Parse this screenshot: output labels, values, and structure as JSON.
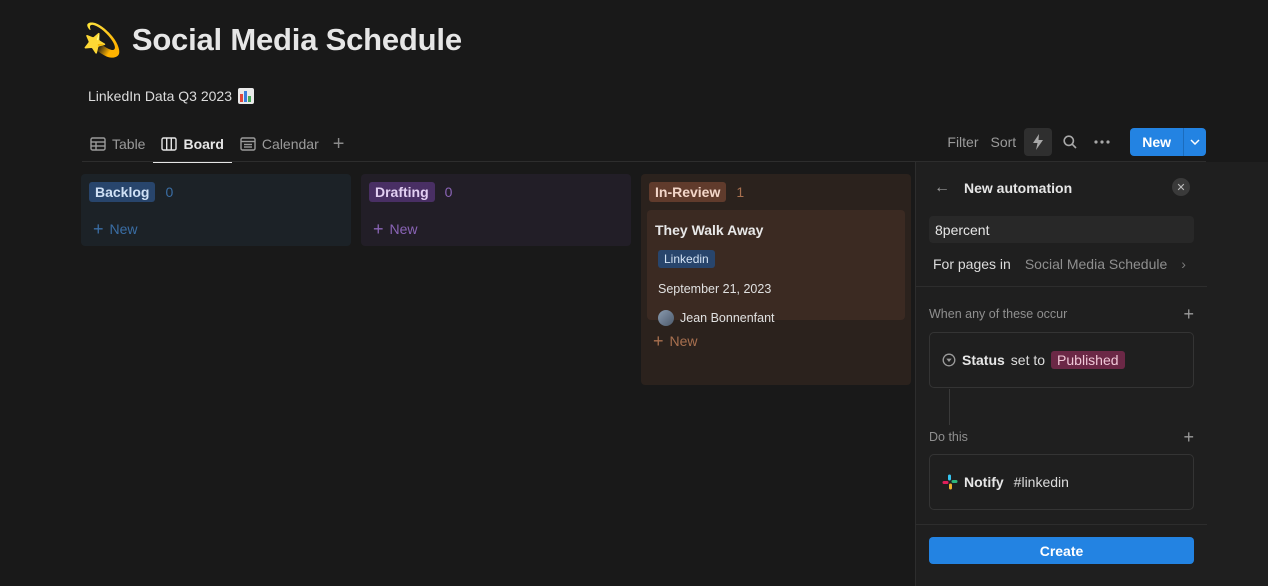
{
  "page": {
    "emoji": "💫",
    "title": "Social Media Schedule",
    "subtitle": "LinkedIn Data Q3 2023"
  },
  "tabs": [
    {
      "label": "Table",
      "icon": "table-icon"
    },
    {
      "label": "Board",
      "icon": "board-icon",
      "active": true
    },
    {
      "label": "Calendar",
      "icon": "calendar-icon"
    }
  ],
  "toolbar": {
    "filter": "Filter",
    "sort": "Sort",
    "new": "New"
  },
  "columns": [
    {
      "label": "Backlog",
      "count": "0",
      "new": "New",
      "tag_bg": "#28456c",
      "tag_fg": "#cfe0f5",
      "col_bg": "#1c2227",
      "accent": "#3a6ea5"
    },
    {
      "label": "Drafting",
      "count": "0",
      "new": "New",
      "tag_bg": "#492f64",
      "tag_fg": "#e2cff2",
      "col_bg": "#221e27",
      "accent": "#8a64b6"
    },
    {
      "label": "In-Review",
      "count": "1",
      "new": "New",
      "tag_bg": "#603b2c",
      "tag_fg": "#f2d5c8",
      "col_bg": "#2b221d",
      "accent": "#a8704f"
    }
  ],
  "card": {
    "title": "They Walk Away",
    "tag": "Linkedin",
    "date": "September 21, 2023",
    "person": "Jean Bonnenfant"
  },
  "automation": {
    "header": "New automation",
    "name": "8percent",
    "for_label": "For pages in",
    "for_value": "Social Media Schedule",
    "trigger_section": "When any of these occur",
    "trigger_prop": "Status",
    "trigger_text": "set to",
    "trigger_value": "Published",
    "action_section": "Do this",
    "action_verb": "Notify",
    "action_channel": "#linkedin",
    "create": "Create"
  }
}
